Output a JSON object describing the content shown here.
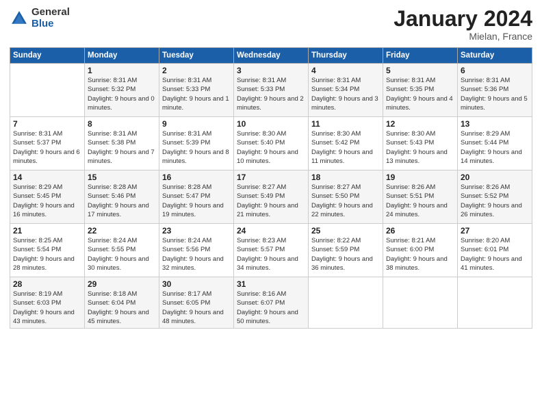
{
  "header": {
    "logo_general": "General",
    "logo_blue": "Blue",
    "month_title": "January 2024",
    "location": "Mielan, France"
  },
  "weekdays": [
    "Sunday",
    "Monday",
    "Tuesday",
    "Wednesday",
    "Thursday",
    "Friday",
    "Saturday"
  ],
  "weeks": [
    [
      {
        "day": "",
        "sunrise": "",
        "sunset": "",
        "daylight": ""
      },
      {
        "day": "1",
        "sunrise": "Sunrise: 8:31 AM",
        "sunset": "Sunset: 5:32 PM",
        "daylight": "Daylight: 9 hours and 0 minutes."
      },
      {
        "day": "2",
        "sunrise": "Sunrise: 8:31 AM",
        "sunset": "Sunset: 5:33 PM",
        "daylight": "Daylight: 9 hours and 1 minute."
      },
      {
        "day": "3",
        "sunrise": "Sunrise: 8:31 AM",
        "sunset": "Sunset: 5:33 PM",
        "daylight": "Daylight: 9 hours and 2 minutes."
      },
      {
        "day": "4",
        "sunrise": "Sunrise: 8:31 AM",
        "sunset": "Sunset: 5:34 PM",
        "daylight": "Daylight: 9 hours and 3 minutes."
      },
      {
        "day": "5",
        "sunrise": "Sunrise: 8:31 AM",
        "sunset": "Sunset: 5:35 PM",
        "daylight": "Daylight: 9 hours and 4 minutes."
      },
      {
        "day": "6",
        "sunrise": "Sunrise: 8:31 AM",
        "sunset": "Sunset: 5:36 PM",
        "daylight": "Daylight: 9 hours and 5 minutes."
      }
    ],
    [
      {
        "day": "7",
        "sunrise": "Sunrise: 8:31 AM",
        "sunset": "Sunset: 5:37 PM",
        "daylight": "Daylight: 9 hours and 6 minutes."
      },
      {
        "day": "8",
        "sunrise": "Sunrise: 8:31 AM",
        "sunset": "Sunset: 5:38 PM",
        "daylight": "Daylight: 9 hours and 7 minutes."
      },
      {
        "day": "9",
        "sunrise": "Sunrise: 8:31 AM",
        "sunset": "Sunset: 5:39 PM",
        "daylight": "Daylight: 9 hours and 8 minutes."
      },
      {
        "day": "10",
        "sunrise": "Sunrise: 8:30 AM",
        "sunset": "Sunset: 5:40 PM",
        "daylight": "Daylight: 9 hours and 10 minutes."
      },
      {
        "day": "11",
        "sunrise": "Sunrise: 8:30 AM",
        "sunset": "Sunset: 5:42 PM",
        "daylight": "Daylight: 9 hours and 11 minutes."
      },
      {
        "day": "12",
        "sunrise": "Sunrise: 8:30 AM",
        "sunset": "Sunset: 5:43 PM",
        "daylight": "Daylight: 9 hours and 13 minutes."
      },
      {
        "day": "13",
        "sunrise": "Sunrise: 8:29 AM",
        "sunset": "Sunset: 5:44 PM",
        "daylight": "Daylight: 9 hours and 14 minutes."
      }
    ],
    [
      {
        "day": "14",
        "sunrise": "Sunrise: 8:29 AM",
        "sunset": "Sunset: 5:45 PM",
        "daylight": "Daylight: 9 hours and 16 minutes."
      },
      {
        "day": "15",
        "sunrise": "Sunrise: 8:28 AM",
        "sunset": "Sunset: 5:46 PM",
        "daylight": "Daylight: 9 hours and 17 minutes."
      },
      {
        "day": "16",
        "sunrise": "Sunrise: 8:28 AM",
        "sunset": "Sunset: 5:47 PM",
        "daylight": "Daylight: 9 hours and 19 minutes."
      },
      {
        "day": "17",
        "sunrise": "Sunrise: 8:27 AM",
        "sunset": "Sunset: 5:49 PM",
        "daylight": "Daylight: 9 hours and 21 minutes."
      },
      {
        "day": "18",
        "sunrise": "Sunrise: 8:27 AM",
        "sunset": "Sunset: 5:50 PM",
        "daylight": "Daylight: 9 hours and 22 minutes."
      },
      {
        "day": "19",
        "sunrise": "Sunrise: 8:26 AM",
        "sunset": "Sunset: 5:51 PM",
        "daylight": "Daylight: 9 hours and 24 minutes."
      },
      {
        "day": "20",
        "sunrise": "Sunrise: 8:26 AM",
        "sunset": "Sunset: 5:52 PM",
        "daylight": "Daylight: 9 hours and 26 minutes."
      }
    ],
    [
      {
        "day": "21",
        "sunrise": "Sunrise: 8:25 AM",
        "sunset": "Sunset: 5:54 PM",
        "daylight": "Daylight: 9 hours and 28 minutes."
      },
      {
        "day": "22",
        "sunrise": "Sunrise: 8:24 AM",
        "sunset": "Sunset: 5:55 PM",
        "daylight": "Daylight: 9 hours and 30 minutes."
      },
      {
        "day": "23",
        "sunrise": "Sunrise: 8:24 AM",
        "sunset": "Sunset: 5:56 PM",
        "daylight": "Daylight: 9 hours and 32 minutes."
      },
      {
        "day": "24",
        "sunrise": "Sunrise: 8:23 AM",
        "sunset": "Sunset: 5:57 PM",
        "daylight": "Daylight: 9 hours and 34 minutes."
      },
      {
        "day": "25",
        "sunrise": "Sunrise: 8:22 AM",
        "sunset": "Sunset: 5:59 PM",
        "daylight": "Daylight: 9 hours and 36 minutes."
      },
      {
        "day": "26",
        "sunrise": "Sunrise: 8:21 AM",
        "sunset": "Sunset: 6:00 PM",
        "daylight": "Daylight: 9 hours and 38 minutes."
      },
      {
        "day": "27",
        "sunrise": "Sunrise: 8:20 AM",
        "sunset": "Sunset: 6:01 PM",
        "daylight": "Daylight: 9 hours and 41 minutes."
      }
    ],
    [
      {
        "day": "28",
        "sunrise": "Sunrise: 8:19 AM",
        "sunset": "Sunset: 6:03 PM",
        "daylight": "Daylight: 9 hours and 43 minutes."
      },
      {
        "day": "29",
        "sunrise": "Sunrise: 8:18 AM",
        "sunset": "Sunset: 6:04 PM",
        "daylight": "Daylight: 9 hours and 45 minutes."
      },
      {
        "day": "30",
        "sunrise": "Sunrise: 8:17 AM",
        "sunset": "Sunset: 6:05 PM",
        "daylight": "Daylight: 9 hours and 48 minutes."
      },
      {
        "day": "31",
        "sunrise": "Sunrise: 8:16 AM",
        "sunset": "Sunset: 6:07 PM",
        "daylight": "Daylight: 9 hours and 50 minutes."
      },
      {
        "day": "",
        "sunrise": "",
        "sunset": "",
        "daylight": ""
      },
      {
        "day": "",
        "sunrise": "",
        "sunset": "",
        "daylight": ""
      },
      {
        "day": "",
        "sunrise": "",
        "sunset": "",
        "daylight": ""
      }
    ]
  ]
}
